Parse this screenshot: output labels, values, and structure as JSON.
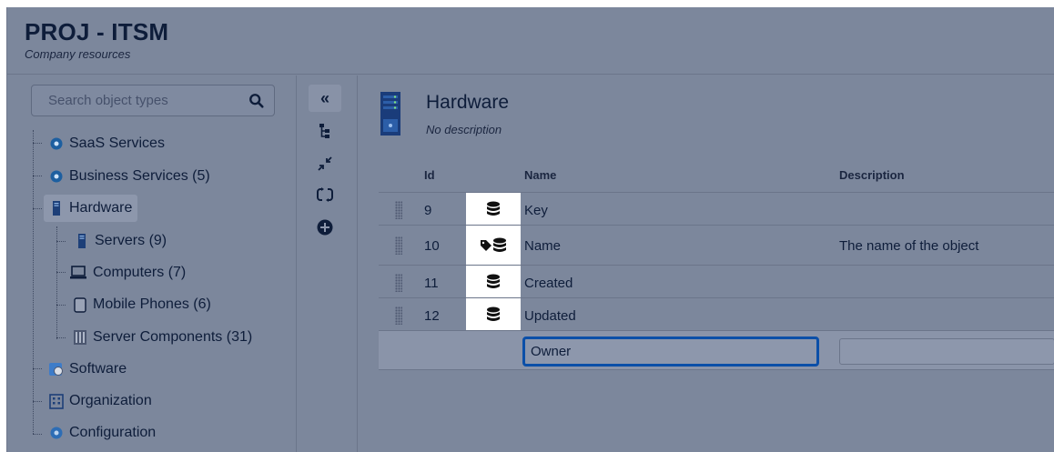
{
  "header": {
    "title": "PROJ - ITSM",
    "subtitle": "Company resources"
  },
  "sidebar": {
    "search_placeholder": "Search object types",
    "items": [
      {
        "label": "SaaS Services",
        "icon": "saas-icon"
      },
      {
        "label": "Business Services (5)",
        "icon": "business-services-icon"
      },
      {
        "label": "Hardware",
        "icon": "hardware-icon",
        "selected": true
      },
      {
        "label": "Servers (9)",
        "icon": "server-icon"
      },
      {
        "label": "Computers (7)",
        "icon": "computer-icon"
      },
      {
        "label": "Mobile Phones (6)",
        "icon": "mobile-phone-icon"
      },
      {
        "label": "Server Components (31)",
        "icon": "server-components-icon"
      },
      {
        "label": "Software",
        "icon": "software-icon"
      },
      {
        "label": "Organization",
        "icon": "organization-icon"
      },
      {
        "label": "Configuration",
        "icon": "configuration-icon"
      }
    ]
  },
  "toolbar": {
    "collapse": "«"
  },
  "object_type": {
    "title": "Hardware",
    "description": "No description"
  },
  "attributes": {
    "columns": {
      "id": "Id",
      "name": "Name",
      "description": "Description"
    },
    "rows": [
      {
        "id": "9",
        "name": "Key",
        "description": ""
      },
      {
        "id": "10",
        "name": "Name",
        "description": "The name of the object"
      },
      {
        "id": "11",
        "name": "Created",
        "description": ""
      },
      {
        "id": "12",
        "name": "Updated",
        "description": ""
      }
    ],
    "new_attribute": {
      "name_value": "Owner",
      "description_value": ""
    }
  },
  "colors": {
    "background": "#7c879c",
    "selected": "#8d97ac",
    "focus_border": "#0b4fa8",
    "saas_icon": "#1d5fa0"
  }
}
